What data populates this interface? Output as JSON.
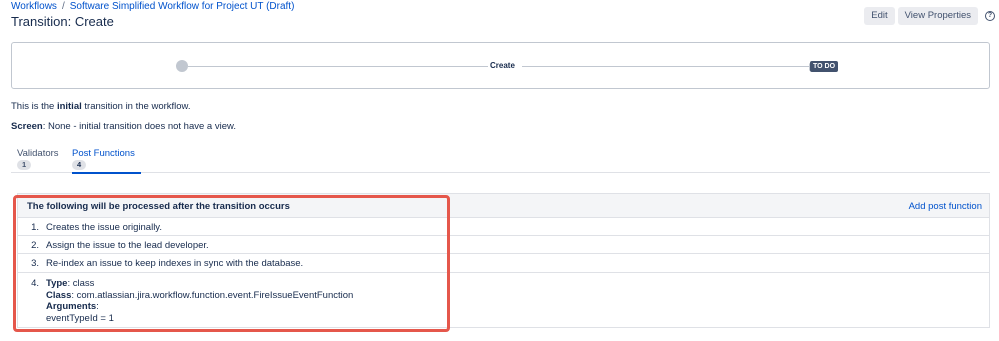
{
  "breadcrumb": {
    "items": [
      "Workflows",
      "Software Simplified Workflow for Project UT (Draft)"
    ],
    "separator": "/"
  },
  "page_title": "Transition: Create",
  "header_actions": {
    "edit_label": "Edit",
    "view_properties_label": "View Properties",
    "help_icon": "help-icon"
  },
  "diagram": {
    "transition_label": "Create",
    "target_status": "TO DO"
  },
  "info": {
    "line1_prefix": "This is the ",
    "line1_bold": "initial",
    "line1_suffix": " transition in the workflow.",
    "screen_label": "Screen",
    "screen_value": ": None - initial transition does not have a view."
  },
  "tabs": [
    {
      "label": "Validators",
      "count": "1"
    },
    {
      "label": "Post Functions",
      "count": "4"
    }
  ],
  "post_functions": {
    "header": "The following will be processed after the transition occurs",
    "add_label": "Add post function",
    "items": [
      {
        "num": "1.",
        "text": "Creates the issue originally."
      },
      {
        "num": "2.",
        "text": "Assign the issue to the lead developer."
      },
      {
        "num": "3.",
        "text": "Re-index an issue to keep indexes in sync with the database."
      }
    ],
    "item4": {
      "num": "4.",
      "type_label": "Type",
      "type_value": ": class",
      "class_label": "Class",
      "class_value": ": com.atlassian.jira.workflow.function.event.FireIssueEventFunction",
      "arguments_label": "Arguments",
      "arguments_colon": ":",
      "argument": "eventTypeId = 1"
    }
  },
  "colors": {
    "link": "#0052cc",
    "text": "#172b4d",
    "highlight": "#e5574b",
    "lozenge": "#42526e"
  }
}
